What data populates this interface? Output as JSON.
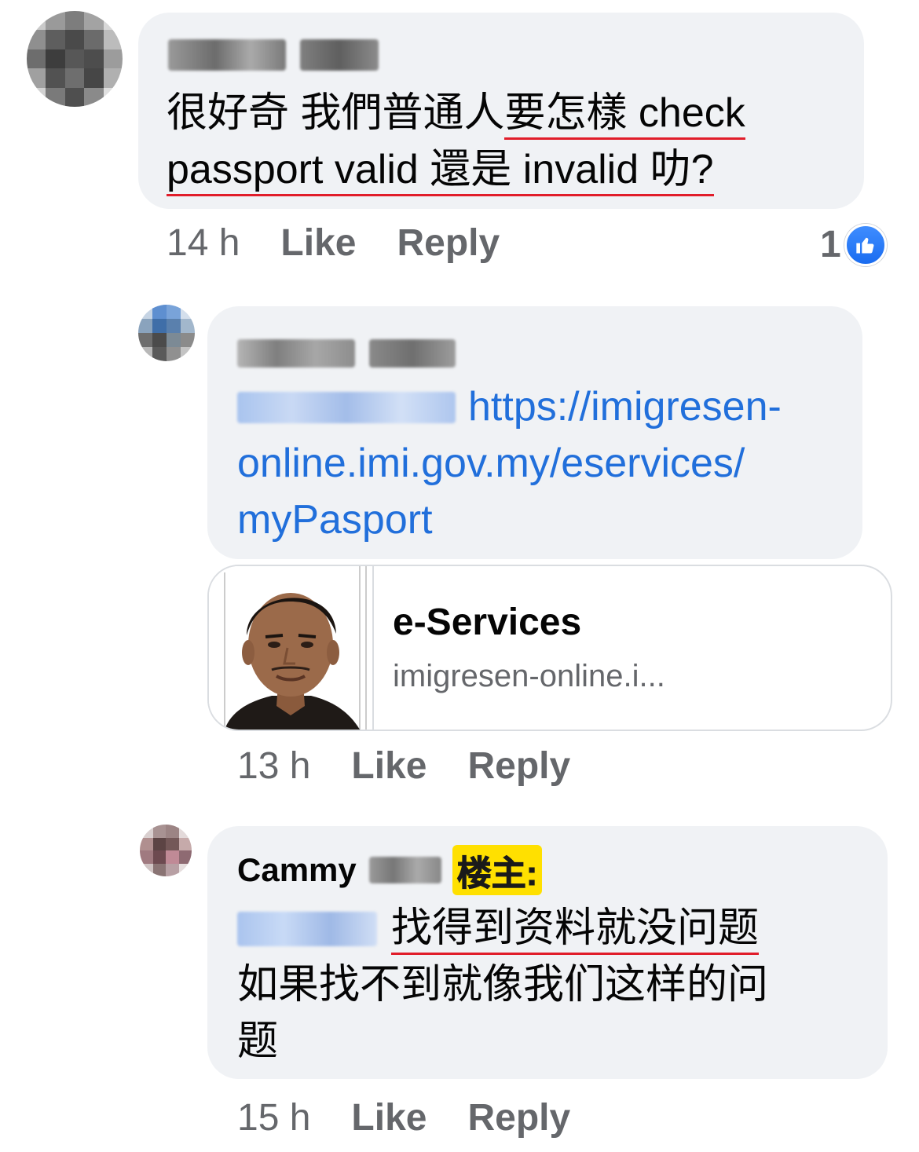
{
  "comments": [
    {
      "text_part1": "很好奇 我們普通人",
      "text_part2_underlined": "要怎樣 check",
      "text_line2_underlined": "passport valid 還是 invalid 叻?",
      "time": "14 h",
      "like_label": "Like",
      "reply_label": "Reply",
      "reaction_count": "1"
    },
    {
      "link_part1": "https://imigresen-",
      "link_part2": "online.imi.gov.my/eservices/",
      "link_part3": "myPasport",
      "card_title": "e-Services",
      "card_domain": "imigresen-online.i...",
      "time": "13 h",
      "like_label": "Like",
      "reply_label": "Reply"
    },
    {
      "author_first": "Cammy",
      "op_tag": "楼主:",
      "text_line1_underlined": "找得到资料就没问题",
      "text_line2": "如果找不到就像我们这样的问",
      "text_line3": "题",
      "time": "15 h",
      "like_label": "Like",
      "reply_label": "Reply"
    }
  ],
  "icons": {
    "like_reaction": "thumbs-up-icon"
  },
  "colors": {
    "bubble": "#f0f2f5",
    "link": "#216fdb",
    "meta_text": "#65676b",
    "underline_red": "#e11d2a",
    "op_tag_bg": "#ffe000",
    "like_blue": "#1877f2"
  }
}
